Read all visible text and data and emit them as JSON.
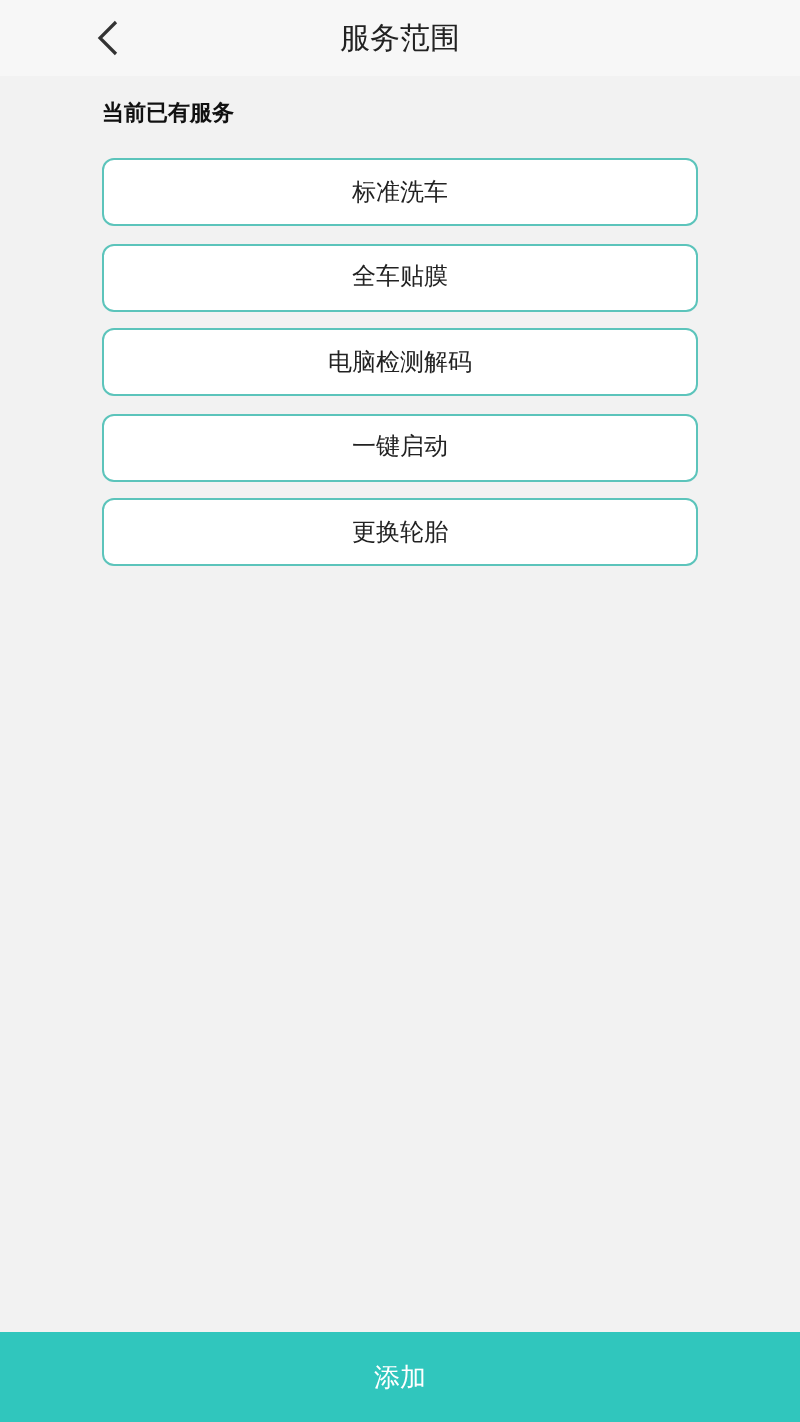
{
  "header": {
    "title": "服务范围"
  },
  "section_title": "当前已有服务",
  "services": [
    {
      "label": "标准洗车"
    },
    {
      "label": "全车贴膜"
    },
    {
      "label": "电脑检测解码"
    },
    {
      "label": "一键启动"
    },
    {
      "label": "更换轮胎"
    }
  ],
  "add_button": {
    "label": "添加"
  }
}
